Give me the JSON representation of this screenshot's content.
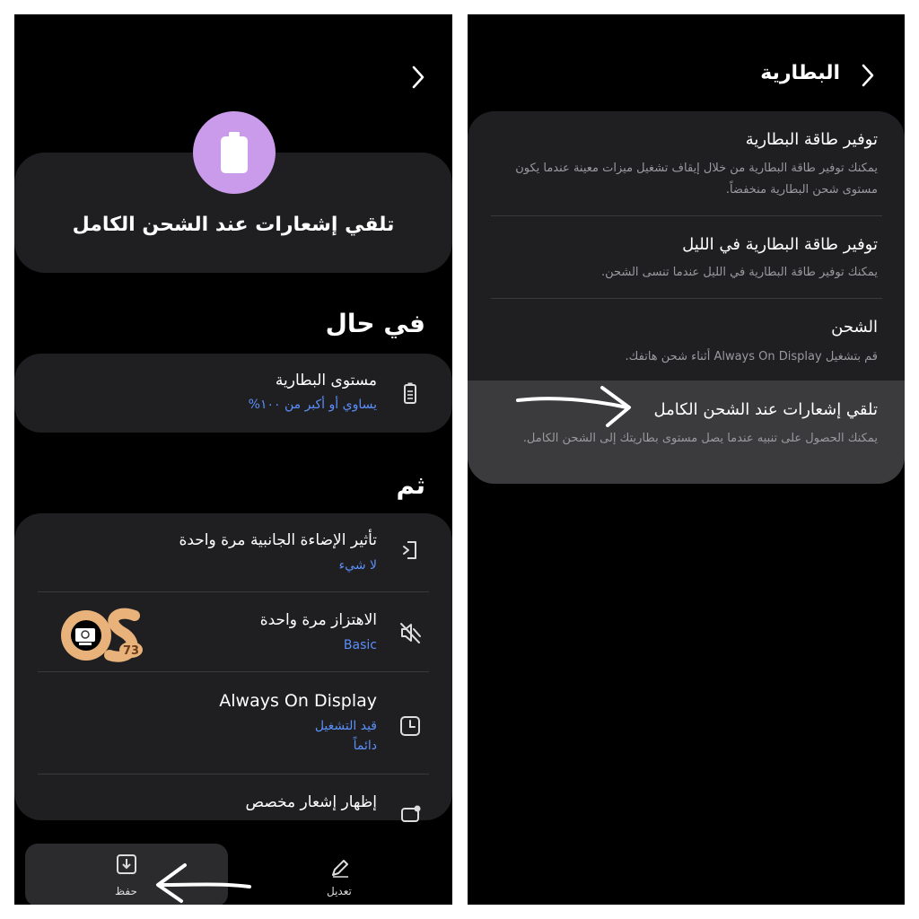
{
  "left": {
    "hero_title": "تلقي إشعارات عند الشحن الكامل",
    "section_if": "في حال",
    "condition": {
      "title": "مستوى البطارية",
      "value": "يساوي أو أكبر من ١٠٠%"
    },
    "section_then": "ثم",
    "actions": [
      {
        "title": "تأثير الإضاءة الجانبية مرة واحدة",
        "value": "لا شيء",
        "icon": "edge-lighting-icon"
      },
      {
        "title": "الاهتزاز مرة واحدة",
        "value": "Basic",
        "icon": "vibration-off-icon"
      },
      {
        "title": "Always On Display",
        "value": "قيد التشغيل",
        "value2": "دائماً",
        "icon": "clock-icon"
      },
      {
        "title": "إظهار إشعار مخصص",
        "icon": "notification-icon"
      }
    ],
    "bottom": {
      "save_label": "حفظ",
      "edit_label": "تعديل"
    },
    "logo": {
      "text": "OS",
      "number": "73"
    }
  },
  "right": {
    "header_title": "البطارية",
    "items": [
      {
        "title": "توفير طاقة البطارية",
        "desc": "يمكنك توفير طاقة البطارية من خلال إيقاف تشغيل ميزات معينة عندما يكون مستوى شحن البطارية منخفضاً."
      },
      {
        "title": "توفير طاقة البطارية في الليل",
        "desc": "يمكنك توفير طاقة البطارية في الليل عندما تنسى الشحن."
      },
      {
        "title": "الشحن",
        "desc": "قم بتشغيل Always On Display أثناء شحن هاتفك."
      },
      {
        "title": "تلقي إشعارات عند الشحن الكامل",
        "desc": "يمكنك الحصول على تنبيه عندما يصل مستوى بطاريتك إلى الشحن الكامل."
      }
    ]
  },
  "colors": {
    "accent_blue": "#5b8ff9",
    "hero_circle": "#c99bea",
    "card_bg": "#1f1f22",
    "highlight_bg": "#3b3b3e"
  }
}
